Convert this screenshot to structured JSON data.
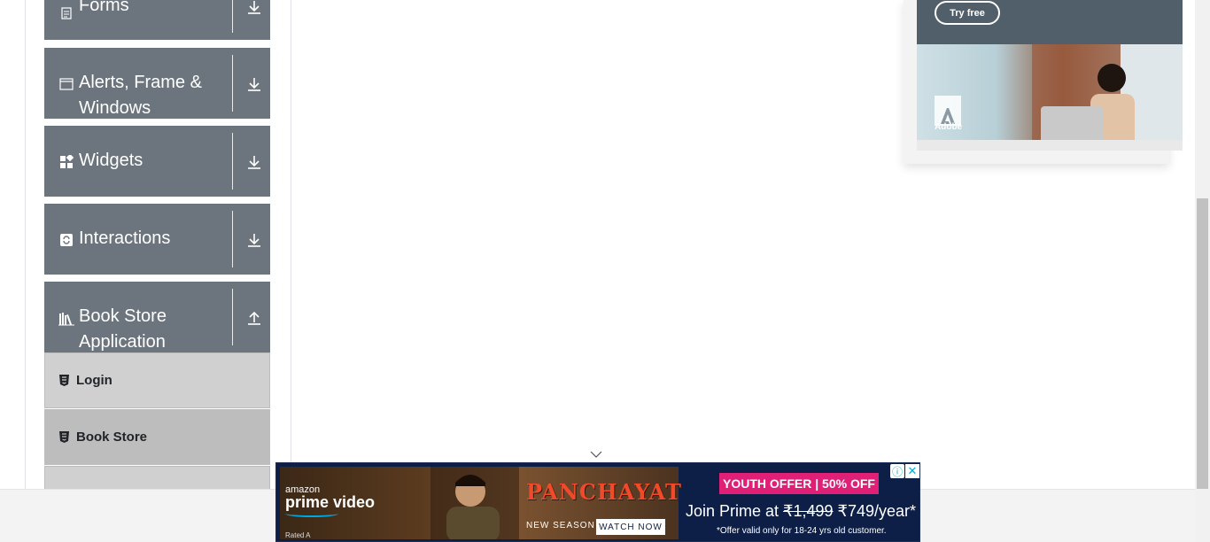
{
  "sidebar": {
    "groups": [
      {
        "label": "Forms",
        "icon": "document-icon",
        "expanded": false
      },
      {
        "label": "Alerts, Frame & Windows",
        "icon": "window-icon",
        "expanded": false
      },
      {
        "label": "Widgets",
        "icon": "widgets-icon",
        "expanded": false
      },
      {
        "label": "Interactions",
        "icon": "interactions-icon",
        "expanded": false
      },
      {
        "label": "Book Store Application",
        "icon": "bookshelf-icon",
        "expanded": true
      }
    ],
    "book_store_items": [
      {
        "label": "Login",
        "icon": "html5-icon"
      },
      {
        "label": "Book Store",
        "icon": "html5-icon"
      }
    ]
  },
  "top_ad": {
    "button_label": "Try free",
    "brand": "Adobe"
  },
  "banner_ad": {
    "brand_small": "amazon",
    "brand_large": "prime video",
    "rating": "Rated A",
    "show_title": "PANCHAYAT",
    "season_label": "NEW SEASON",
    "cta_label": "WATCH NOW",
    "offer_badge": "YOUTH OFFER | 50% OFF",
    "join_prefix": "Join Prime at ",
    "old_price": "₹1,499",
    "new_price": " ₹749/year*",
    "offer_note": "*Offer valid only for 18-24 yrs old customer.",
    "adchoices_label": "ⓘ",
    "close_label": "✕"
  },
  "colors": {
    "sidebar_header": "#6c757d",
    "login_item_bg": "#d0d0d0",
    "bookstore_item_bg": "#bdbdbd",
    "banner_bg": "#0d1f46",
    "offer_pink": "#e01f77"
  }
}
